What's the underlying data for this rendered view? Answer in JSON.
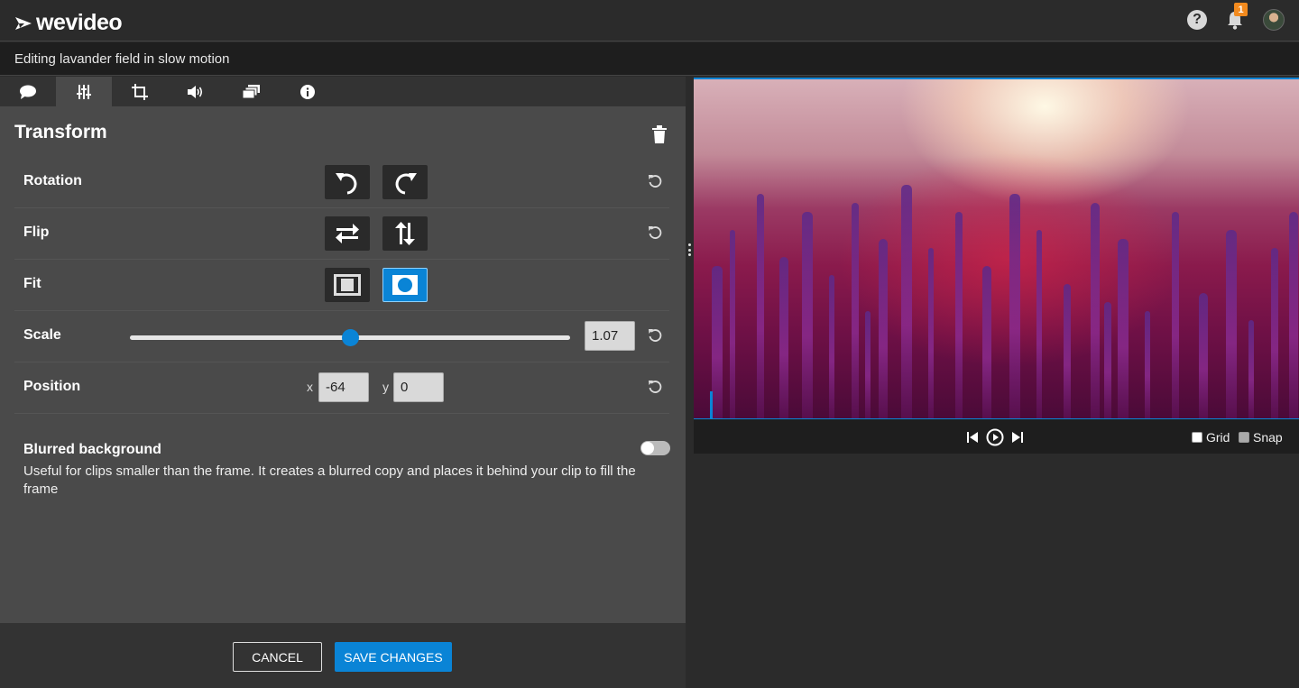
{
  "app": {
    "logo_text": "wevideo",
    "notification_count": "1",
    "editing_title": "Editing lavander field in slow motion"
  },
  "tabs": [
    {
      "icon": "speech-bubble-icon"
    },
    {
      "icon": "sliders-icon",
      "active": true
    },
    {
      "icon": "crop-icon"
    },
    {
      "icon": "volume-icon"
    },
    {
      "icon": "layers-icon"
    },
    {
      "icon": "info-icon"
    }
  ],
  "transform": {
    "title": "Transform",
    "rotation_label": "Rotation",
    "flip_label": "Flip",
    "fit_label": "Fit",
    "scale_label": "Scale",
    "scale_value": "1.07",
    "scale_fraction": 0.5,
    "position_label": "Position",
    "x_label": "x",
    "x_value": "-64",
    "y_label": "y",
    "y_value": "0",
    "blur_title": "Blurred background",
    "blur_description": "Useful for clips smaller than the frame. It creates a blurred copy and places it behind your clip to fill the frame",
    "blur_enabled": false
  },
  "footer": {
    "cancel_label": "CANCEL",
    "save_label": "SAVE CHANGES"
  },
  "preview": {
    "grid_label": "Grid",
    "snap_label": "Snap",
    "grid_checked": false,
    "snap_checked": false
  },
  "colors": {
    "accent": "#0a84d6",
    "badge": "#f28a1e",
    "panel": "#4a4a4a",
    "background": "#2b2b2b"
  }
}
